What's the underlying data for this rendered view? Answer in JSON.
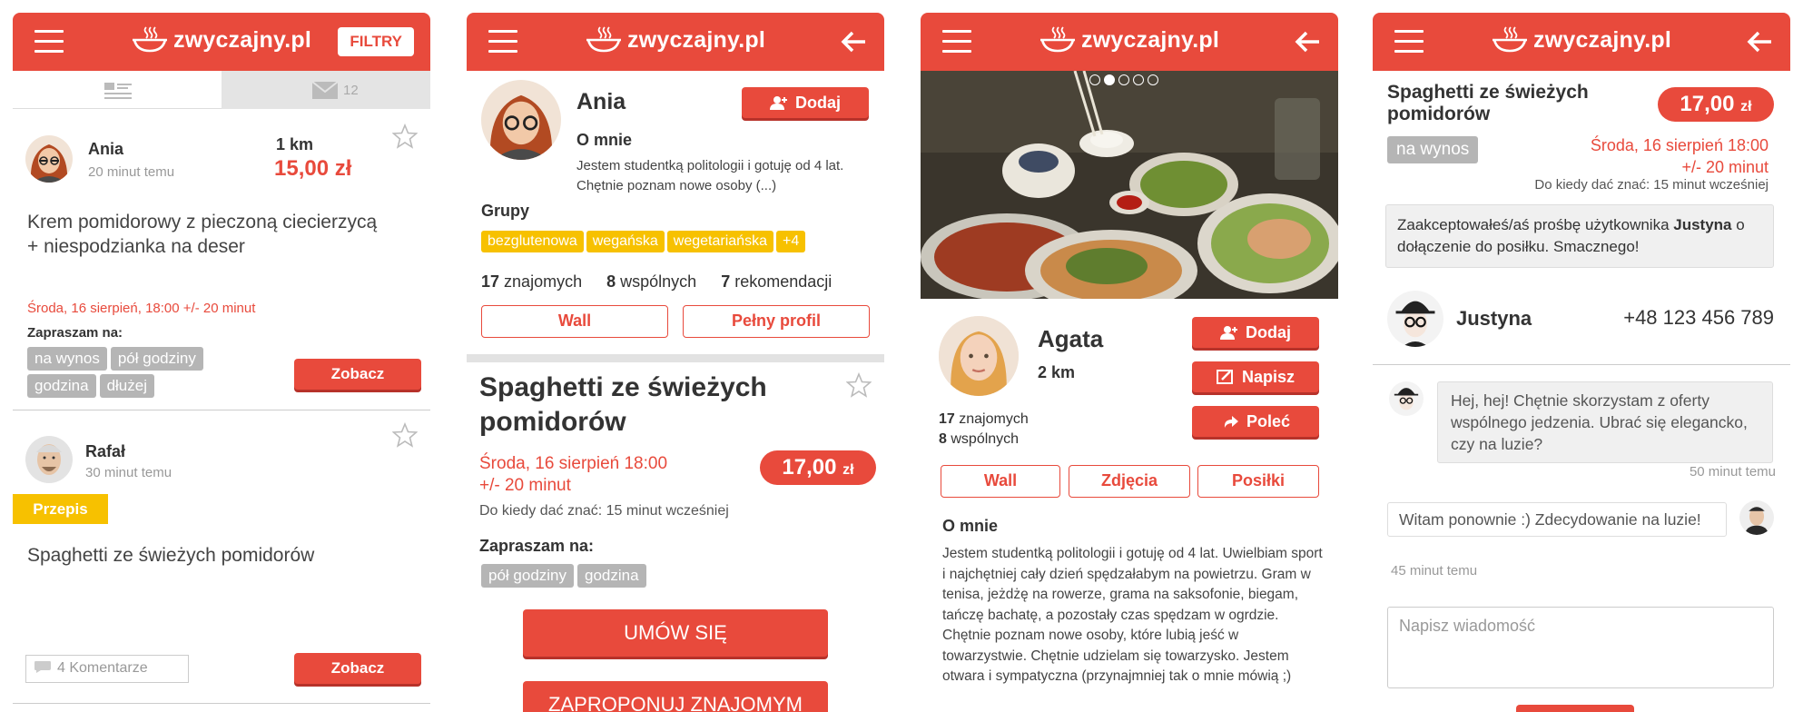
{
  "app": {
    "logo_text": "zwyczajny.pl"
  },
  "s1": {
    "filter_label": "FILTRY",
    "tab_messages_count": "12",
    "post1": {
      "name": "Ania",
      "time": "20 minut temu",
      "distance": "1 km",
      "price": "15,00 zł",
      "title": "Krem pomidorowy z pieczoną ciecierzycą + niespodzianka na deser",
      "date": "Środa, 16 sierpień, 18:00 +/- 20 minut",
      "invite_label": "Zapraszam na:",
      "chips": [
        "na wynos",
        "pół godziny",
        "godzina",
        "dłużej"
      ],
      "see_button": "Zobacz"
    },
    "post2": {
      "name": "Rafał",
      "time": "30 minut temu",
      "badge": "Przepis",
      "title": "Spaghetti ze świeżych pomidorów",
      "comments": "4 Komentarze",
      "see_button": "Zobacz"
    }
  },
  "s2": {
    "name": "Ania",
    "add_button": "Dodaj",
    "about_heading": "O mnie",
    "about_text": "Jestem studentką politologii i gotuję od 4 lat. Chętnie poznam nowe osoby (...)",
    "groups_label": "Grupy",
    "groups": [
      "bezglutenowa",
      "wegańska",
      "wegetariańska",
      "+4"
    ],
    "stats": [
      {
        "num": "17",
        "label": "znajomych"
      },
      {
        "num": "8",
        "label": "wspólnych"
      },
      {
        "num": "7",
        "label": "rekomendacji"
      }
    ],
    "wall_button": "Wall",
    "profile_button": "Pełny profil",
    "dish_title": "Spaghetti ze świeżych pomidorów",
    "date_line1": "Środa, 16 sierpień 18:00",
    "date_line2": "+/- 20 minut",
    "deadline": "Do kiedy dać znać: 15 minut wcześniej",
    "price": "17,00",
    "currency": "zł",
    "invite_label": "Zapraszam na:",
    "chips": [
      "pół godziny",
      "godzina"
    ],
    "arrange_button": "UMÓW SIĘ",
    "propose_button": "ZAPROPONUJ ZNAJOMYM"
  },
  "s3": {
    "carousel_dots": 5,
    "carousel_active": 1,
    "name": "Agata",
    "distance": "2 km",
    "friends": {
      "num": "17",
      "label": "znajomych"
    },
    "mutual": {
      "num": "8",
      "label": "wspólnych"
    },
    "add_button": "Dodaj",
    "write_button": "Napisz",
    "recommend_button": "Poleć",
    "tabs": [
      "Wall",
      "Zdjęcia",
      "Posiłki"
    ],
    "about_heading": "O mnie",
    "about_text": "Jestem studentką politologii i gotuję od 4 lat. Uwielbiam sport i najchętniej cały dzień spędzałabym na powietrzu. Gram w tenisa, jeżdżę na rowerze, grama na saksofonie, biegam, tańczę bachatę, a pozostały czas spędzam w ogrdzie. Chętnie poznam nowe osoby, które lubią jeść w towarzystwie. Chętnie udzielam się towarzysko. Jestem otwara i sympatyczna (przynajmniej tak o mnie mówią ;)"
  },
  "s4": {
    "dish_title": "Spaghetti ze świeżych pomidorów",
    "price": "17,00",
    "currency": "zł",
    "chip": "na wynos",
    "date_line1": "Środa, 16 sierpień 18:00",
    "date_line2": "+/- 20 minut",
    "deadline": "Do kiedy dać znać: 15 minut wcześniej",
    "notice_pre": "Zaakceptowałeś/aś prośbę użytkownika ",
    "notice_user": "Justyna",
    "notice_post": " o dołączenie do posiłku. Smacznego!",
    "contact_name": "Justyna",
    "contact_phone": "+48 123 456 789",
    "msg1": "Hej, hej! Chętnie skorzystam z oferty wspólnego jedzenia. Ubrać się elegancko, czy na luzie?",
    "msg1_time": "50 minut temu",
    "msg2": "Witam ponownie :) Zdecydowanie na luzie!",
    "msg2_time": "45 minut temu",
    "input_placeholder": "Napisz wiadomość"
  },
  "colors": {
    "brand_red": "#e84a3c",
    "tag_yellow": "#f7c100",
    "chip_gray": "#b5b5b5"
  }
}
